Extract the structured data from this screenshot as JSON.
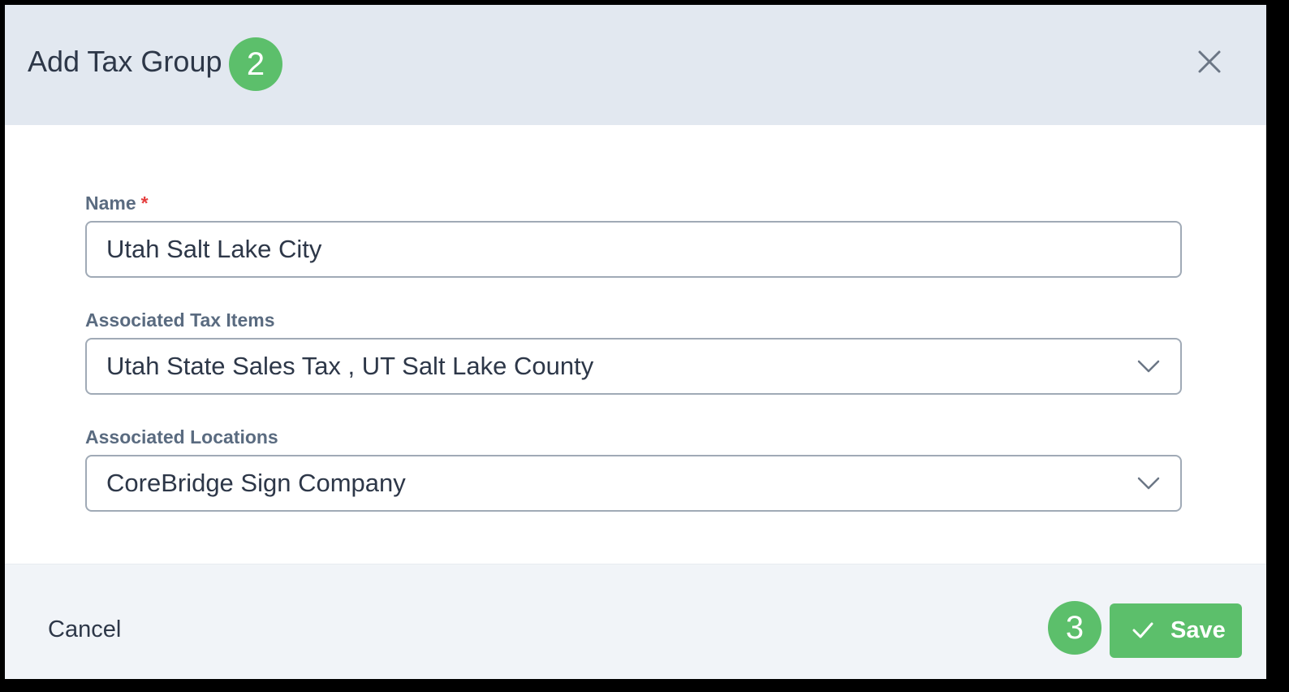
{
  "dialog": {
    "title": "Add Tax Group",
    "title_step": "2",
    "close_icon": "close-icon"
  },
  "form": {
    "name": {
      "label": "Name",
      "required_marker": "*",
      "value": "Utah Salt Lake City"
    },
    "tax_items": {
      "label": "Associated Tax Items",
      "value": "Utah State Sales Tax , UT Salt Lake County",
      "icon": "chevron-down-icon"
    },
    "locations": {
      "label": "Associated Locations",
      "value": "CoreBridge Sign Company",
      "icon": "chevron-down-icon"
    }
  },
  "footer": {
    "cancel_label": "Cancel",
    "save_step": "3",
    "save_label": "Save",
    "save_icon": "check-icon"
  },
  "colors": {
    "header_bg": "#e2e8f0",
    "accent_green": "#5cbf6b",
    "required_red": "#e53e3e",
    "footer_bg": "#f1f4f8"
  }
}
